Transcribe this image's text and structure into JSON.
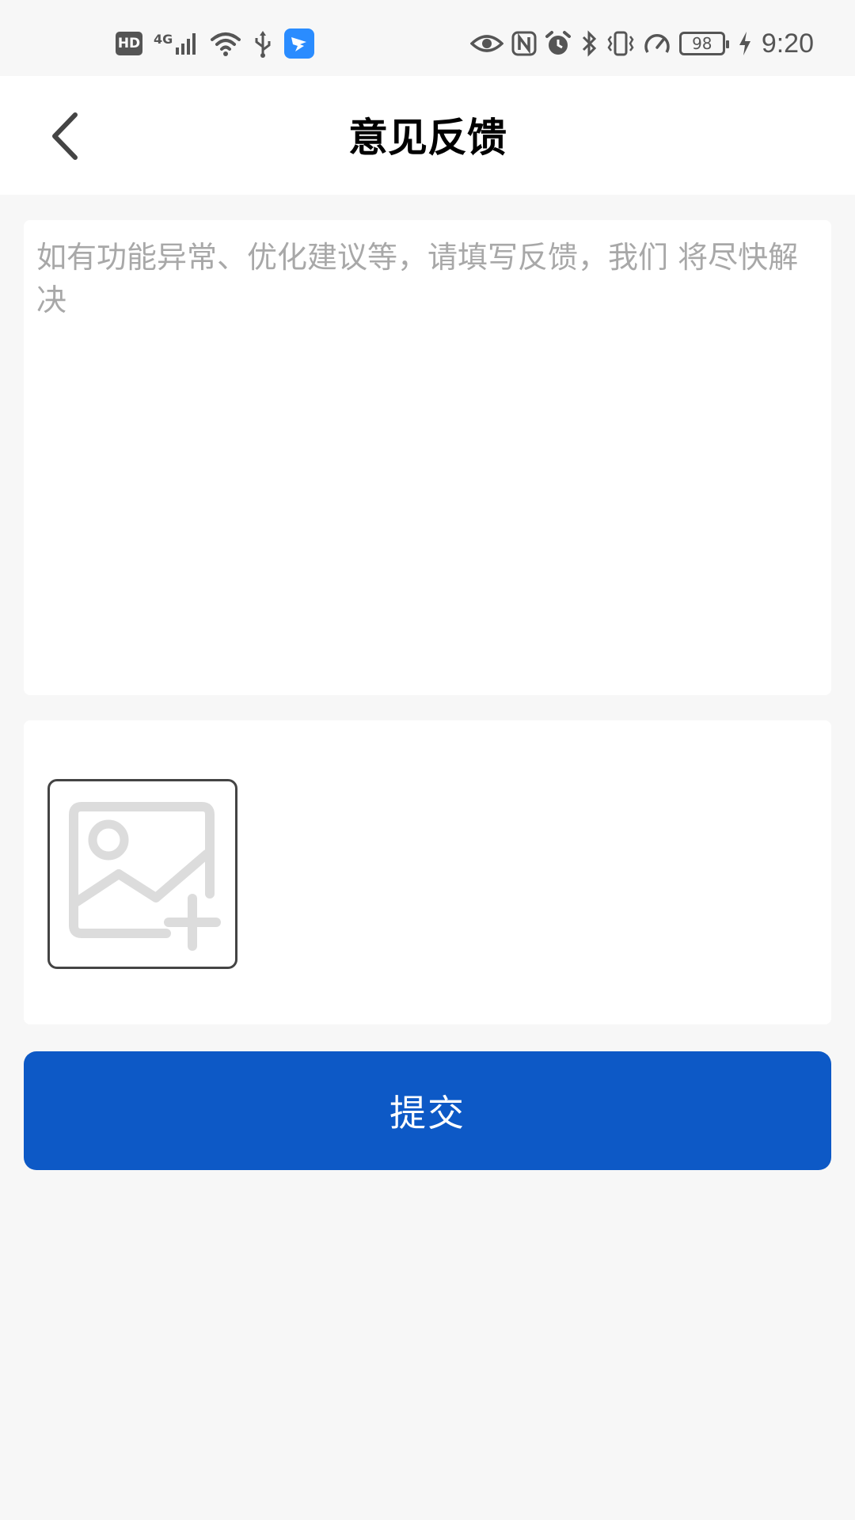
{
  "status_bar": {
    "hd_label": "HD",
    "network_label": "4G",
    "battery_level": "98",
    "time": "9:20"
  },
  "navbar": {
    "title": "意见反馈"
  },
  "feedback": {
    "value": "",
    "placeholder": "如有功能异常、优化建议等，请填写反馈，我们 将尽快解决"
  },
  "submit": {
    "label": "提交"
  },
  "colors": {
    "accent": "#0d59c6",
    "background": "#f7f7f7",
    "placeholder": "#a8a8a8"
  }
}
